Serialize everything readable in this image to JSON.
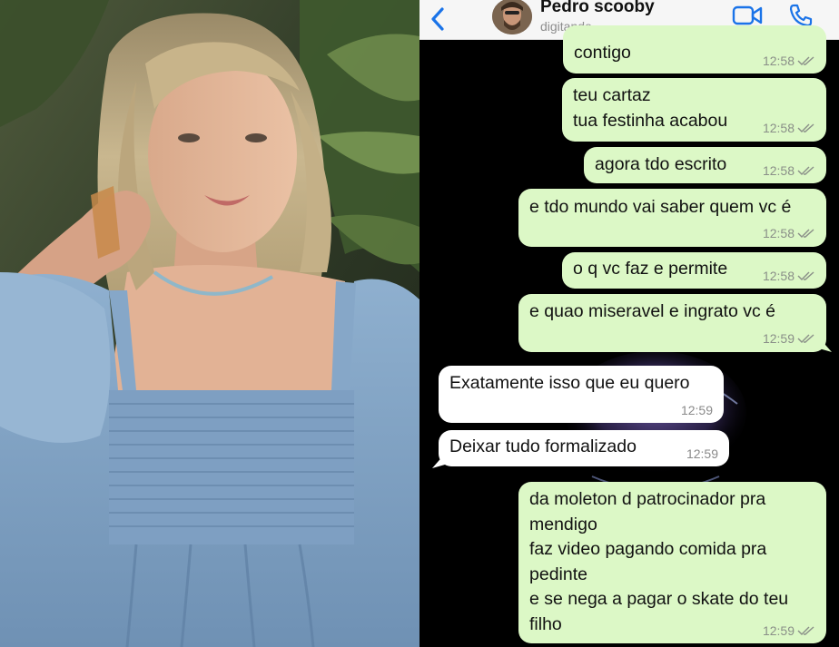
{
  "chat": {
    "header": {
      "contact_name": "Pedro scooby",
      "status": "digitando..."
    },
    "colors": {
      "outgoing_bubble": "#dcf8c6",
      "incoming_bubble": "#ffffff",
      "chat_background": "#000000",
      "accent": "#1a73e8"
    },
    "icons": [
      "chevron-left-icon",
      "video-camera-icon",
      "phone-icon",
      "double-check-icon"
    ],
    "messages": [
      {
        "direction": "out",
        "text": "contigo",
        "time": "12:58"
      },
      {
        "direction": "out",
        "text": "teu cartaz\ntua festinha acabou",
        "time": "12:58"
      },
      {
        "direction": "out",
        "text": "agora tdo escrito",
        "time": "12:58"
      },
      {
        "direction": "out",
        "text": "e tdo mundo vai saber quem vc é",
        "time": "12:58"
      },
      {
        "direction": "out",
        "text": "o q vc faz e permite",
        "time": "12:58"
      },
      {
        "direction": "out",
        "text": "e quao miseravel e ingrato vc é",
        "time": "12:59"
      },
      {
        "direction": "in",
        "text": "Exatamente isso que eu quero",
        "time": "12:59"
      },
      {
        "direction": "in",
        "text": "Deixar tudo formalizado",
        "time": "12:59"
      },
      {
        "direction": "out",
        "text": "da moleton d patrocinador pra\nmendigo\nfaz video pagando comida pra\npedinte\ne se nega a pagar o skate do teu\nfilho",
        "time": "12:59"
      }
    ]
  }
}
